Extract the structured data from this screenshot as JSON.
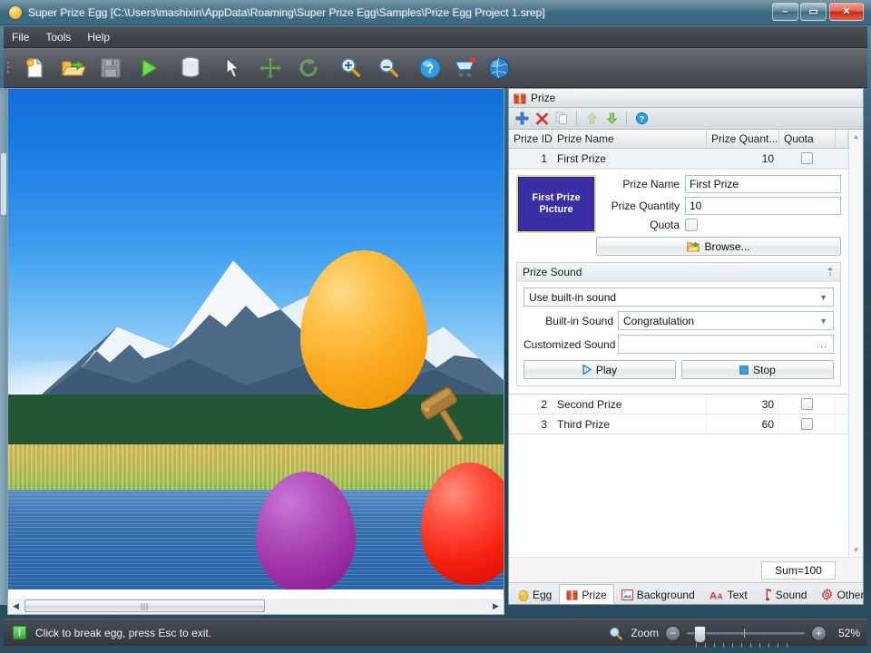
{
  "window": {
    "title": "Super Prize Egg [C:\\Users\\mashixin\\AppData\\Roaming\\Super Prize Egg\\Samples\\Prize Egg Project 1.srep]",
    "icon": "egg-icon",
    "minimize_label": "–",
    "maximize_label": "▭",
    "close_label": "✕"
  },
  "menu": {
    "items": [
      {
        "label": "File",
        "name": "menu-file"
      },
      {
        "label": "Tools",
        "name": "menu-tools"
      },
      {
        "label": "Help",
        "name": "menu-help"
      }
    ]
  },
  "toolbar": {
    "buttons": [
      {
        "name": "new-project-button",
        "icon": "new-document-icon",
        "tooltip": "New"
      },
      {
        "name": "open-project-button",
        "icon": "open-folder-icon",
        "tooltip": "Open"
      },
      {
        "name": "save-project-button",
        "icon": "floppy-save-icon",
        "tooltip": "Save"
      },
      {
        "name": "run-button",
        "icon": "play-triangle-icon",
        "tooltip": "Run"
      },
      {
        "name": "database-button",
        "icon": "database-icon",
        "tooltip": "Database"
      },
      {
        "name": "select-tool-button",
        "icon": "arrow-cursor-icon",
        "tooltip": "Select"
      },
      {
        "name": "move-tool-button",
        "icon": "move-cross-icon",
        "tooltip": "Move"
      },
      {
        "name": "rotate-tool-button",
        "icon": "rotate-arrow-icon",
        "tooltip": "Rotate"
      },
      {
        "name": "zoom-in-button",
        "icon": "magnifier-plus-icon",
        "tooltip": "Zoom In"
      },
      {
        "name": "zoom-out-button",
        "icon": "magnifier-minus-icon",
        "tooltip": "Zoom Out"
      },
      {
        "name": "help-button",
        "icon": "question-circle-icon",
        "tooltip": "Help"
      },
      {
        "name": "buy-button",
        "icon": "shopping-cart-icon",
        "tooltip": "Buy"
      },
      {
        "name": "website-button",
        "icon": "globe-icon",
        "tooltip": "Website"
      }
    ]
  },
  "canvas": {
    "background_name": "mountain-lake-photo",
    "eggs": [
      {
        "name": "egg-orange",
        "color": "#f9a81d",
        "label": "First Prize egg"
      },
      {
        "name": "egg-purple",
        "color": "#9e2fa8",
        "label": "Second Prize egg"
      },
      {
        "name": "egg-red",
        "color": "#f51f0e",
        "label": "Third Prize egg"
      }
    ],
    "cursor": "hammer-cursor",
    "hscroll": {
      "left_arrow": "◀",
      "right_arrow": "▶"
    }
  },
  "dock": {
    "caption": "Prize",
    "caption_icon": "gift-box-icon",
    "toolbar": [
      {
        "name": "add-prize-button",
        "icon": "plus-icon"
      },
      {
        "name": "delete-prize-button",
        "icon": "red-x-icon"
      },
      {
        "name": "copy-prize-button",
        "icon": "copy-icon"
      },
      {
        "name": "move-up-button",
        "icon": "arrow-up-icon"
      },
      {
        "name": "move-down-button",
        "icon": "arrow-down-icon"
      },
      {
        "name": "prize-help-button",
        "icon": "question-circle-icon"
      }
    ],
    "grid": {
      "columns": [
        "Prize ID",
        "Prize Name",
        "Prize Quant...",
        "Quota"
      ],
      "rows": [
        {
          "id": "1",
          "name": "First Prize",
          "quantity": "10",
          "quota_checked": false,
          "selected": true
        },
        {
          "id": "2",
          "name": "Second Prize",
          "quantity": "30",
          "quota_checked": false,
          "selected": false
        },
        {
          "id": "3",
          "name": "Third Prize",
          "quantity": "60",
          "quota_checked": false,
          "selected": false
        }
      ]
    },
    "detail": {
      "picture_placeholder": "First Prize Picture",
      "picture_line1": "First Prize",
      "picture_line2": "Picture",
      "prize_name_label": "Prize Name",
      "prize_name_value": "First Prize",
      "prize_quantity_label": "Prize Quantity",
      "prize_quantity_value": "10",
      "quota_label": "Quota",
      "quota_checked": false,
      "browse_label": "Browse...",
      "browse_icon": "open-folder-icon"
    },
    "sound": {
      "group_title": "Prize Sound",
      "collapse_icon": "chevron-up-double-icon",
      "mode_value": "Use built-in sound",
      "builtin_label": "Built-in Sound",
      "builtin_value": "Congratulation",
      "customized_label": "Customized Sound",
      "customized_value": "",
      "customized_browse": "...",
      "play_label": "Play",
      "play_icon": "play-triangle-icon",
      "stop_label": "Stop",
      "stop_icon": "stop-square-icon"
    },
    "sum_text": "Sum=100",
    "scroll": {
      "up_arrow": "▲",
      "down_arrow": "▼"
    },
    "tabs": [
      {
        "label": "Egg",
        "icon": "egg-icon",
        "name": "tab-egg",
        "active": false
      },
      {
        "label": "Prize",
        "icon": "gift-box-icon",
        "name": "tab-prize",
        "active": true
      },
      {
        "label": "Background",
        "icon": "picture-icon",
        "name": "tab-background",
        "active": false
      },
      {
        "label": "Text",
        "icon": "font-letters-icon",
        "name": "tab-text",
        "active": false
      },
      {
        "label": "Sound",
        "icon": "music-note-icon",
        "name": "tab-sound",
        "active": false
      },
      {
        "label": "Other",
        "icon": "gear-icon",
        "name": "tab-other",
        "active": false
      }
    ]
  },
  "statusbar": {
    "icon": "info-icon",
    "icon_glyph": "i",
    "message": "Click to break egg, press Esc to exit.",
    "zoom_icon": "magnifier-icon",
    "zoom_label": "Zoom",
    "zoom_out_glyph": "−",
    "zoom_in_glyph": "+",
    "zoom_percent": "52%"
  }
}
